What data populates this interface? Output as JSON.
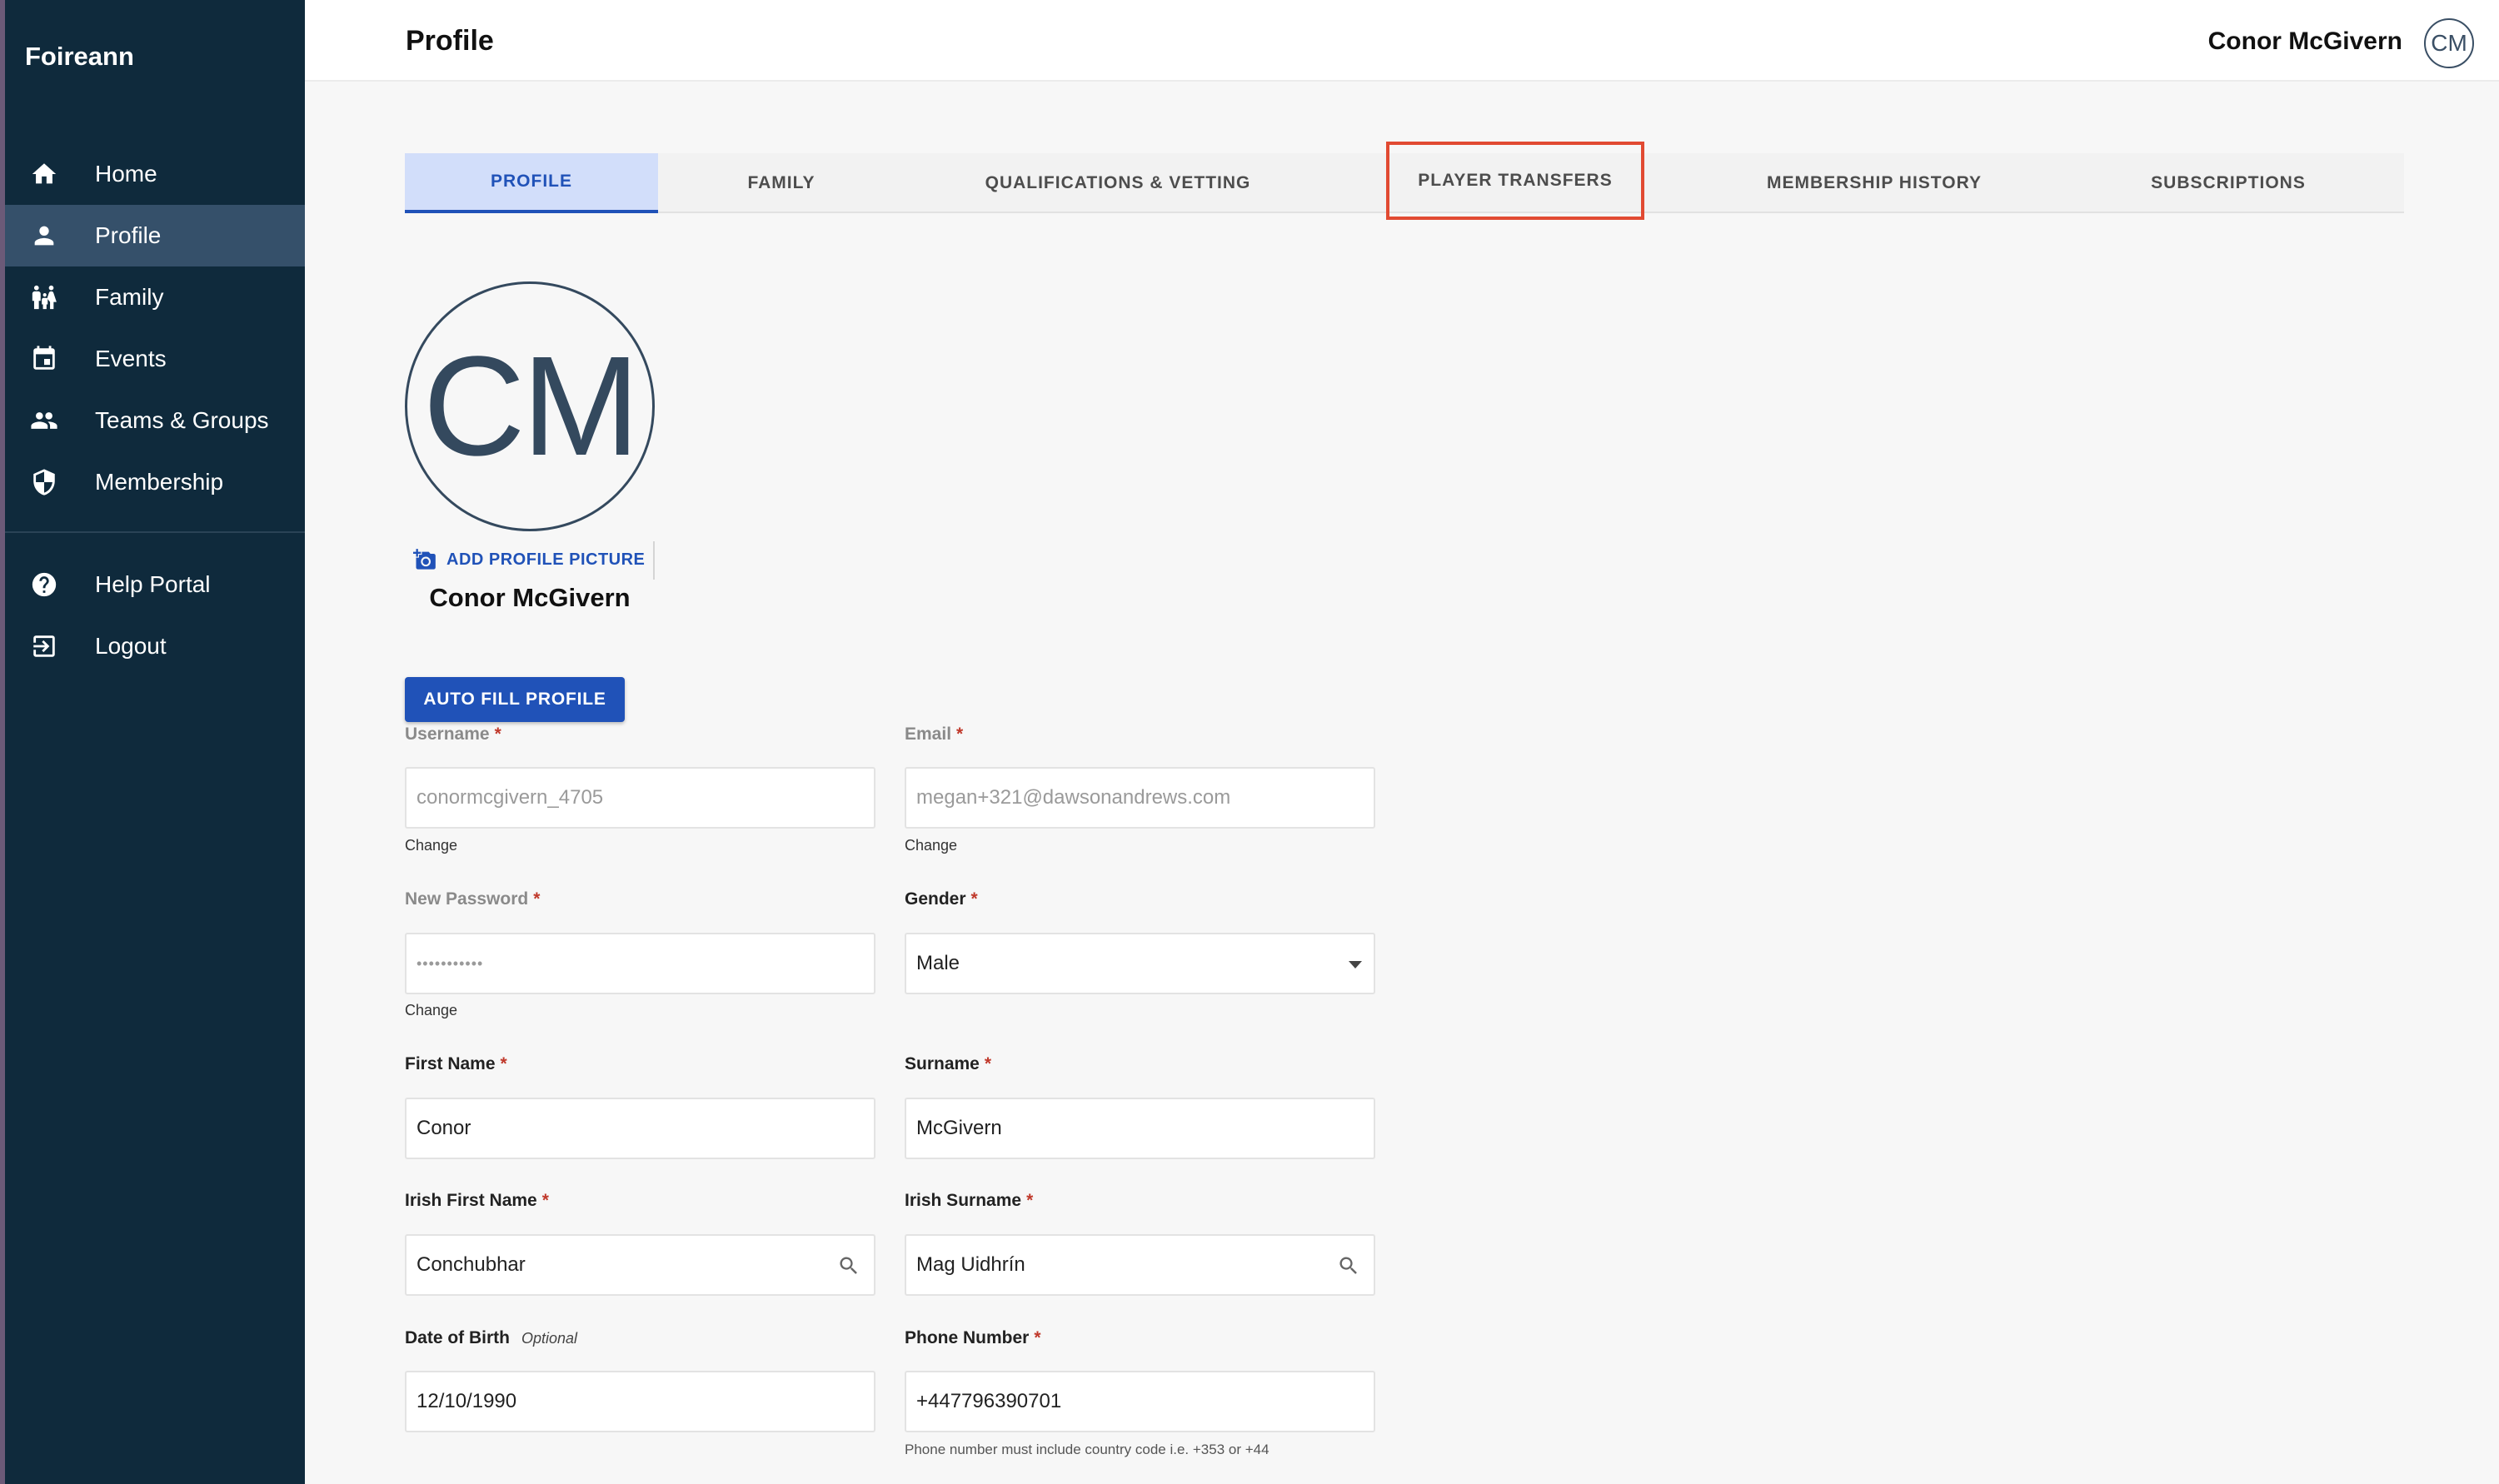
{
  "app": {
    "brand": "Foireann"
  },
  "sidebar": {
    "items": [
      {
        "label": "Home",
        "icon": "home-icon"
      },
      {
        "label": "Profile",
        "icon": "person-icon",
        "active": true
      },
      {
        "label": "Family",
        "icon": "family-icon"
      },
      {
        "label": "Events",
        "icon": "calendar-icon"
      },
      {
        "label": "Teams & Groups",
        "icon": "group-icon"
      },
      {
        "label": "Membership",
        "icon": "shield-icon"
      },
      {
        "label": "Help Portal",
        "icon": "help-icon"
      },
      {
        "label": "Logout",
        "icon": "logout-icon"
      }
    ]
  },
  "header": {
    "title": "Profile",
    "user_name": "Conor McGivern",
    "avatar_initials": "CM"
  },
  "tabs": [
    {
      "label": "PROFILE",
      "active": true
    },
    {
      "label": "FAMILY"
    },
    {
      "label": "QUALIFICATIONS & VETTING"
    },
    {
      "label": "PLAYER TRANSFERS",
      "highlighted": true
    },
    {
      "label": "MEMBERSHIP HISTORY"
    },
    {
      "label": "SUBSCRIPTIONS"
    }
  ],
  "profile": {
    "initials": "CM",
    "add_picture_label": "ADD PROFILE PICTURE",
    "name": "Conor McGivern",
    "autofill_label": "AUTO FILL PROFILE"
  },
  "form": {
    "username": {
      "label": "Username",
      "value": "conormcgivern_4705",
      "change": "Change"
    },
    "email": {
      "label": "Email",
      "value": "megan+321@dawsonandrews.com",
      "change": "Change"
    },
    "password": {
      "label": "New Password",
      "value": "•••••••••••",
      "change": "Change"
    },
    "gender": {
      "label": "Gender",
      "value": "Male"
    },
    "first_name": {
      "label": "First Name",
      "value": "Conor"
    },
    "surname": {
      "label": "Surname",
      "value": "McGivern"
    },
    "irish_first_name": {
      "label": "Irish First Name",
      "value": "Conchubhar"
    },
    "irish_surname": {
      "label": "Irish Surname",
      "value": "Mag Uidhrín"
    },
    "dob": {
      "label": "Date of Birth",
      "optional": "Optional",
      "value": "12/10/1990"
    },
    "phone": {
      "label": "Phone Number",
      "value": "+447796390701",
      "helper": "Phone number must include country code i.e. +353 or +44"
    },
    "required_mark": "*"
  },
  "colors": {
    "sidebar": "#0f2a3c",
    "active_nav": "#35506a",
    "accent": "#2052b8",
    "highlight": "#e14a32"
  }
}
